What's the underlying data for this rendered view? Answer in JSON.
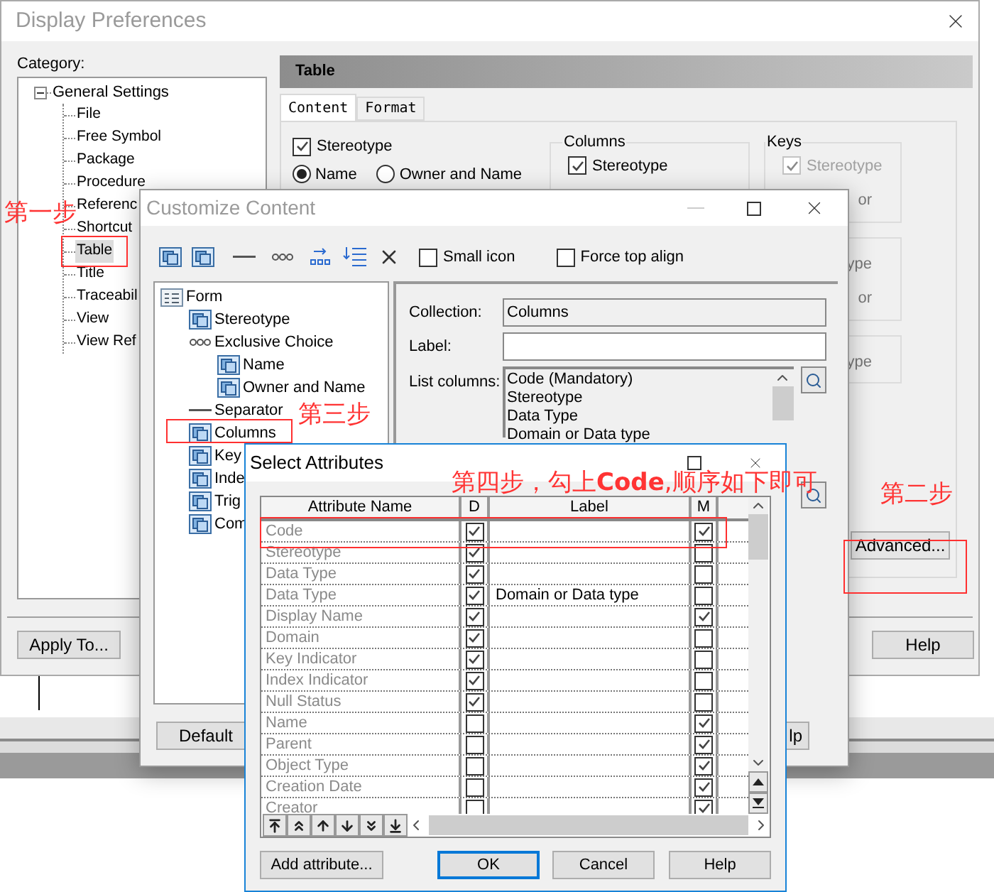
{
  "display_preferences": {
    "title": "Display Preferences",
    "category_label": "Category:",
    "category_tree": {
      "label": "General Settings",
      "expanded": true,
      "children": [
        {
          "label": "File",
          "selected": false
        },
        {
          "label": "Free Symbol",
          "selected": false
        },
        {
          "label": "Package",
          "selected": false
        },
        {
          "label": "Procedure",
          "selected": false
        },
        {
          "label": "Referenc",
          "selected": false
        },
        {
          "label": "Shortcut",
          "selected": false
        },
        {
          "label": "Table",
          "selected": true
        },
        {
          "label": "Title",
          "selected": false
        },
        {
          "label": "Traceabil",
          "selected": false
        },
        {
          "label": "View",
          "selected": false
        },
        {
          "label": "View Ref",
          "selected": false
        }
      ]
    },
    "panel_title": "Table",
    "tabs": [
      {
        "label": "Content",
        "selected": true
      },
      {
        "label": "Format",
        "selected": false
      }
    ],
    "stereotype": {
      "label": "Stereotype",
      "checked": true
    },
    "name_options": [
      {
        "label": "Name",
        "selected": true
      },
      {
        "label": "Owner and Name",
        "selected": false
      }
    ],
    "columns_group": {
      "title": "Columns",
      "items": [
        {
          "label": "Stereotype",
          "checked": true
        }
      ]
    },
    "side_groups": [
      {
        "title": "Keys",
        "items": [
          {
            "kind": "checkbox",
            "label": "Stereotype",
            "checked": true,
            "disabled": true
          },
          {
            "kind": "text",
            "label": "or"
          }
        ]
      },
      {
        "items": [
          {
            "kind": "text",
            "label": "ype"
          },
          {
            "kind": "text",
            "label": "or"
          }
        ]
      },
      {
        "items": [
          {
            "kind": "text",
            "label": "ype"
          }
        ]
      }
    ],
    "advanced_button": "Advanced...",
    "apply_button": "Apply To...",
    "help_button": "Help"
  },
  "customize_content": {
    "title": "Customize Content",
    "toolbar_options": [
      {
        "label": "Small icon",
        "checked": false
      },
      {
        "label": "Force top align",
        "checked": false
      }
    ],
    "tree": {
      "label": "Form",
      "kind": "form",
      "children": [
        {
          "label": "Stereotype",
          "kind": "attribute"
        },
        {
          "label": "Exclusive Choice",
          "kind": "choice",
          "children": [
            {
              "label": "Name",
              "kind": "attribute"
            },
            {
              "label": "Owner and Name",
              "kind": "attribute"
            }
          ]
        },
        {
          "label": "Separator",
          "kind": "separator"
        },
        {
          "label": "Columns",
          "kind": "attribute"
        },
        {
          "label": "Key",
          "kind": "attribute"
        },
        {
          "label": "Inde",
          "kind": "attribute"
        },
        {
          "label": "Trig",
          "kind": "attribute"
        },
        {
          "label": "Com",
          "kind": "attribute"
        }
      ]
    },
    "collection": {
      "label": "Collection:",
      "value": "Columns"
    },
    "label_field": {
      "label": "Label:"
    },
    "list_columns": {
      "label": "List columns:",
      "items": [
        "Code (Mandatory)",
        "Stereotype",
        "Data Type",
        "Domain or Data type"
      ]
    },
    "default_button": "Default",
    "help_button": "lp"
  },
  "select_attributes": {
    "title": "Select Attributes",
    "columns": [
      "Attribute Name",
      "D",
      "Label",
      "M"
    ],
    "rows": [
      {
        "name": "Code",
        "d": true,
        "m": true
      },
      {
        "name": "Stereotype",
        "d": true,
        "m": false
      },
      {
        "name": "Data Type",
        "d": true,
        "m": false
      },
      {
        "name": "Data Type",
        "d": true,
        "label": "Domain or Data type",
        "m": false
      },
      {
        "name": "Display Name",
        "d": true,
        "m": true
      },
      {
        "name": "Domain",
        "d": true,
        "m": false
      },
      {
        "name": "Key Indicator",
        "d": true,
        "m": false
      },
      {
        "name": "Index Indicator",
        "d": true,
        "m": false
      },
      {
        "name": "Null Status",
        "d": true,
        "m": false
      },
      {
        "name": "Name",
        "d": false,
        "m": true
      },
      {
        "name": "Parent",
        "d": false,
        "m": true
      },
      {
        "name": "Object Type",
        "d": false,
        "m": true
      },
      {
        "name": "Creation Date",
        "d": false,
        "m": true
      },
      {
        "name": "Creator",
        "d": false,
        "m": true
      }
    ],
    "buttons": [
      {
        "label": "Add attribute...",
        "default": false
      },
      {
        "label": "OK",
        "default": true
      },
      {
        "label": "Cancel",
        "default": false
      },
      {
        "label": "Help",
        "default": false
      }
    ]
  },
  "annotations": [
    {
      "text": "第一步"
    },
    {
      "text": "第二步"
    },
    {
      "text": "第三步"
    },
    {
      "text": "第四步，勾上**Code**,顺序如下即可"
    }
  ]
}
